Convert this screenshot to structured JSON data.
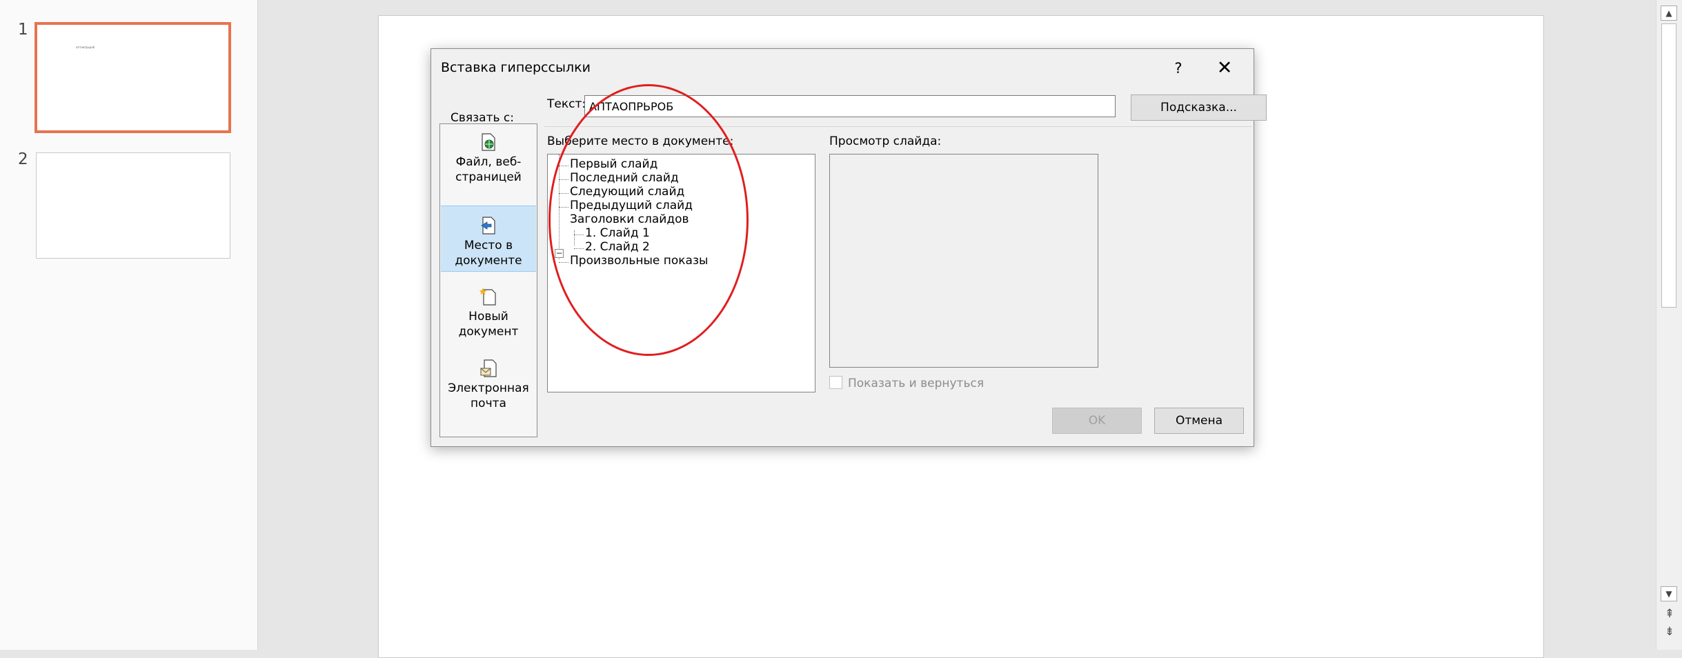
{
  "thumbnails": [
    {
      "number": "1",
      "snippet": "аптаопрьроб"
    },
    {
      "number": "2",
      "snippet": ""
    }
  ],
  "dialog": {
    "title": "Вставка гиперссылки",
    "help": "?",
    "close": "✕",
    "link_to_label": "Связать с:",
    "link_to": [
      {
        "label": "Файл, веб-страницей",
        "icon": "file-web-icon"
      },
      {
        "label": "Место в документе",
        "icon": "place-in-document-icon",
        "selected": true
      },
      {
        "label": "Новый документ",
        "icon": "new-document-icon"
      },
      {
        "label": "Электронная почта",
        "icon": "email-icon"
      }
    ],
    "text_label": "Текст:",
    "text_value": "АПТАОПРЬРОБ",
    "hint_button": "Подсказка...",
    "place_label": "Выберите место в документе:",
    "tree": {
      "first": "Первый слайд",
      "last": "Последний слайд",
      "next": "Следующий слайд",
      "prev": "Предыдущий слайд",
      "titles": "Заголовки слайдов",
      "slide1": "1. Слайд 1",
      "slide2": "2. Слайд 2",
      "custom": "Произвольные показы"
    },
    "preview_label": "Просмотр слайда:",
    "show_return": "Показать и вернуться",
    "ok": "OK",
    "cancel": "Отмена"
  },
  "colors": {
    "selected_thumb_border": "#e8734f",
    "annotation": "#e01e1e",
    "selected_link": "#cce4f7"
  }
}
